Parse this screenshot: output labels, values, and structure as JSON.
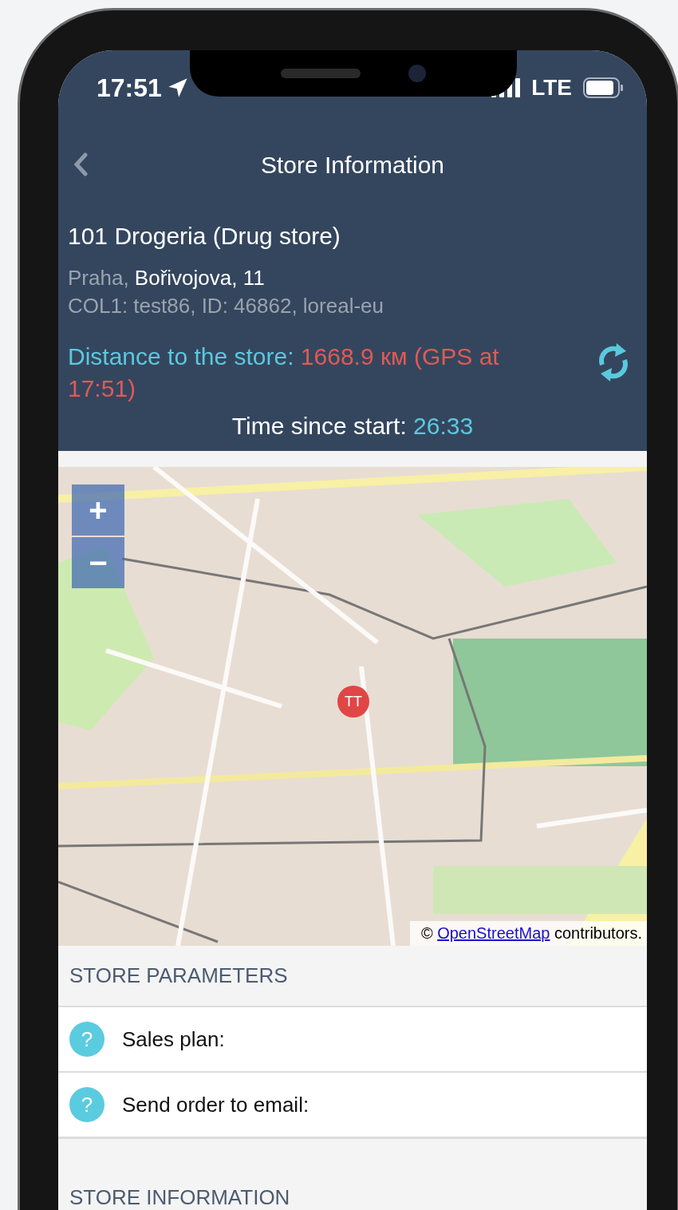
{
  "status_bar": {
    "time": "17:51",
    "network": "LTE"
  },
  "nav": {
    "title": "Store Information"
  },
  "store": {
    "name": "101 Drogeria (Drug store)",
    "city": "Praha,",
    "street": "Bořivojova, 11",
    "codes": "COL1: test86, ID: 46862, loreal-eu",
    "distance_label": "Distance to the store:",
    "distance_value": "1668.9 км (GPS at 17:51)",
    "timer_label": "Time since start:",
    "timer_value": "26:33"
  },
  "map": {
    "zoom_in": "+",
    "zoom_out": "−",
    "marker": "TT",
    "attribution_prefix": "©",
    "attribution_link": "OpenStreetMap",
    "attribution_suffix": "contributors."
  },
  "sections": [
    {
      "title": "STORE PARAMETERS",
      "rows": [
        {
          "icon": "?",
          "label": "Sales plan:"
        },
        {
          "icon": "?",
          "label": "Send order to email:"
        }
      ]
    },
    {
      "title": "STORE INFORMATION"
    }
  ]
}
